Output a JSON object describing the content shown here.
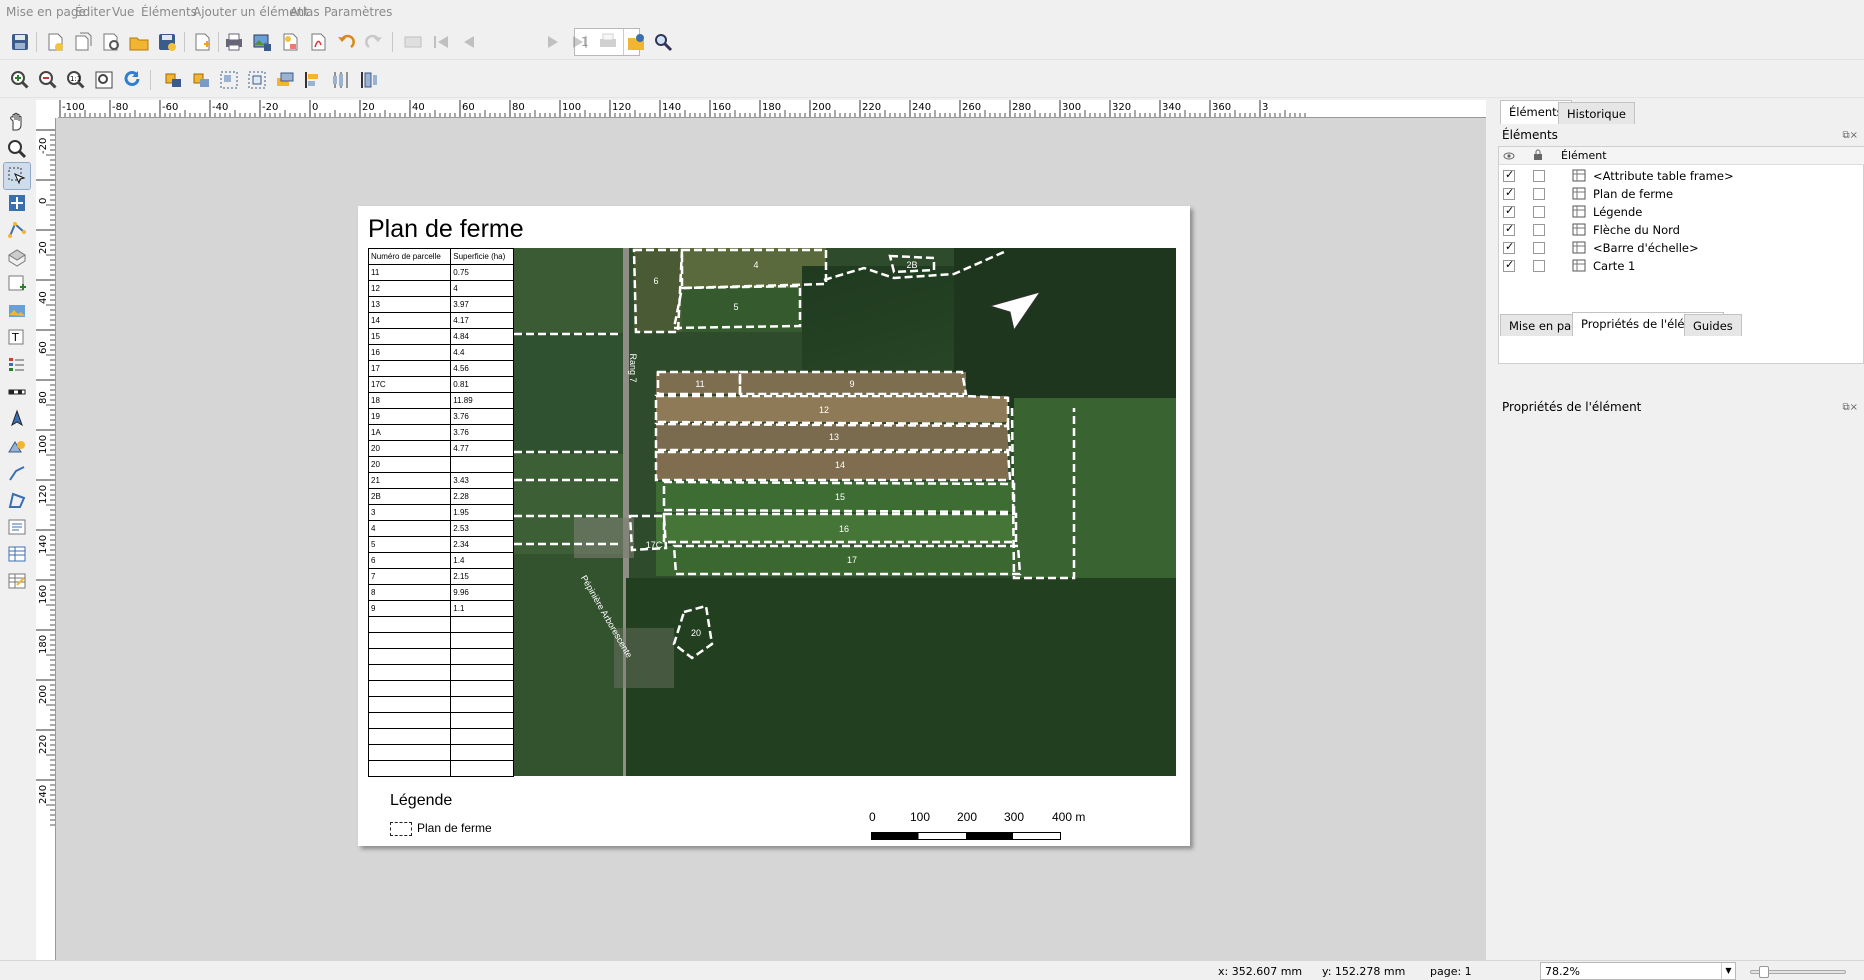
{
  "menu": [
    "Mise en page",
    "Éditer",
    "Vue",
    "Éléments",
    "Ajouter un élément",
    "Atlas",
    "Paramètres"
  ],
  "toolbar": {
    "page_number": "1"
  },
  "ruler": {
    "h_labels": [
      "-100",
      "-80",
      "-60",
      "-40",
      "-20",
      "0",
      "20",
      "40",
      "60",
      "80",
      "100",
      "120",
      "140",
      "160",
      "180",
      "200",
      "220",
      "240",
      "260",
      "280",
      "300",
      "320",
      "340",
      "360",
      "3"
    ],
    "v_labels": [
      "-20",
      "0",
      "20",
      "40",
      "60",
      "80",
      "100",
      "120",
      "140",
      "160",
      "180",
      "200",
      "220",
      "240"
    ]
  },
  "layout": {
    "title": "Plan de ferme",
    "table": {
      "headers": [
        "Numéro de parcelle",
        "Superficie (ha)"
      ],
      "rows": [
        [
          "11",
          "0.75"
        ],
        [
          "12",
          "4"
        ],
        [
          "13",
          "3.97"
        ],
        [
          "14",
          "4.17"
        ],
        [
          "15",
          "4.84"
        ],
        [
          "16",
          "4.4"
        ],
        [
          "17",
          "4.56"
        ],
        [
          "17C",
          "0.81"
        ],
        [
          "18",
          "11.89"
        ],
        [
          "19",
          "3.76"
        ],
        [
          "1A",
          "3.76"
        ],
        [
          "20",
          "4.77"
        ],
        [
          "20",
          ""
        ],
        [
          "21",
          "3.43"
        ],
        [
          "2B",
          "2.28"
        ],
        [
          "3",
          "1.95"
        ],
        [
          "4",
          "2.53"
        ],
        [
          "5",
          "2.34"
        ],
        [
          "6",
          "1.4"
        ],
        [
          "7",
          "2.15"
        ],
        [
          "8",
          "9.96"
        ],
        [
          "9",
          "1.1"
        ],
        [
          "",
          ""
        ],
        [
          "",
          ""
        ],
        [
          "",
          ""
        ],
        [
          "",
          ""
        ],
        [
          "",
          ""
        ],
        [
          "",
          ""
        ],
        [
          "",
          ""
        ],
        [
          "",
          ""
        ],
        [
          "",
          ""
        ],
        [
          "",
          ""
        ]
      ]
    },
    "map": {
      "parcel_labels": [
        "4",
        "6",
        "2B",
        "5",
        "11",
        "9",
        "12",
        "13",
        "14",
        "15",
        "16",
        "17",
        "17C",
        "20"
      ],
      "road_label": "Rang 7",
      "place_label": "Pépinière Arborescente"
    },
    "legend": {
      "title": "Légende",
      "item": "Plan de ferme"
    },
    "scalebar": {
      "labels": [
        "0",
        "100",
        "200",
        "300",
        "400 m"
      ]
    }
  },
  "right_panel": {
    "tabs_top": [
      "Éléments",
      "Historique"
    ],
    "items_title": "Éléments",
    "tree_header": "Élément",
    "items": [
      {
        "label": "<Attribute table frame>",
        "icon": "table-icon",
        "visible": true,
        "locked": false
      },
      {
        "label": "Plan de ferme",
        "icon": "text-label-icon",
        "visible": true,
        "locked": false
      },
      {
        "label": "Légende",
        "icon": "legend-icon",
        "visible": true,
        "locked": false
      },
      {
        "label": "Flèche du Nord",
        "icon": "picture-icon",
        "visible": true,
        "locked": false
      },
      {
        "label": "<Barre d'échelle>",
        "icon": "scalebar-icon",
        "visible": true,
        "locked": false
      },
      {
        "label": "Carte 1",
        "icon": "map-icon",
        "visible": true,
        "locked": false
      }
    ],
    "tabs_bottom": [
      "Mise en page",
      "Propriétés de l'élément",
      "Guides"
    ],
    "props_title": "Propriétés de l'élément"
  },
  "status": {
    "x": "x: 352.607 mm",
    "y": "y: 152.278 mm",
    "page": "page: 1",
    "zoom": "78.2%"
  }
}
